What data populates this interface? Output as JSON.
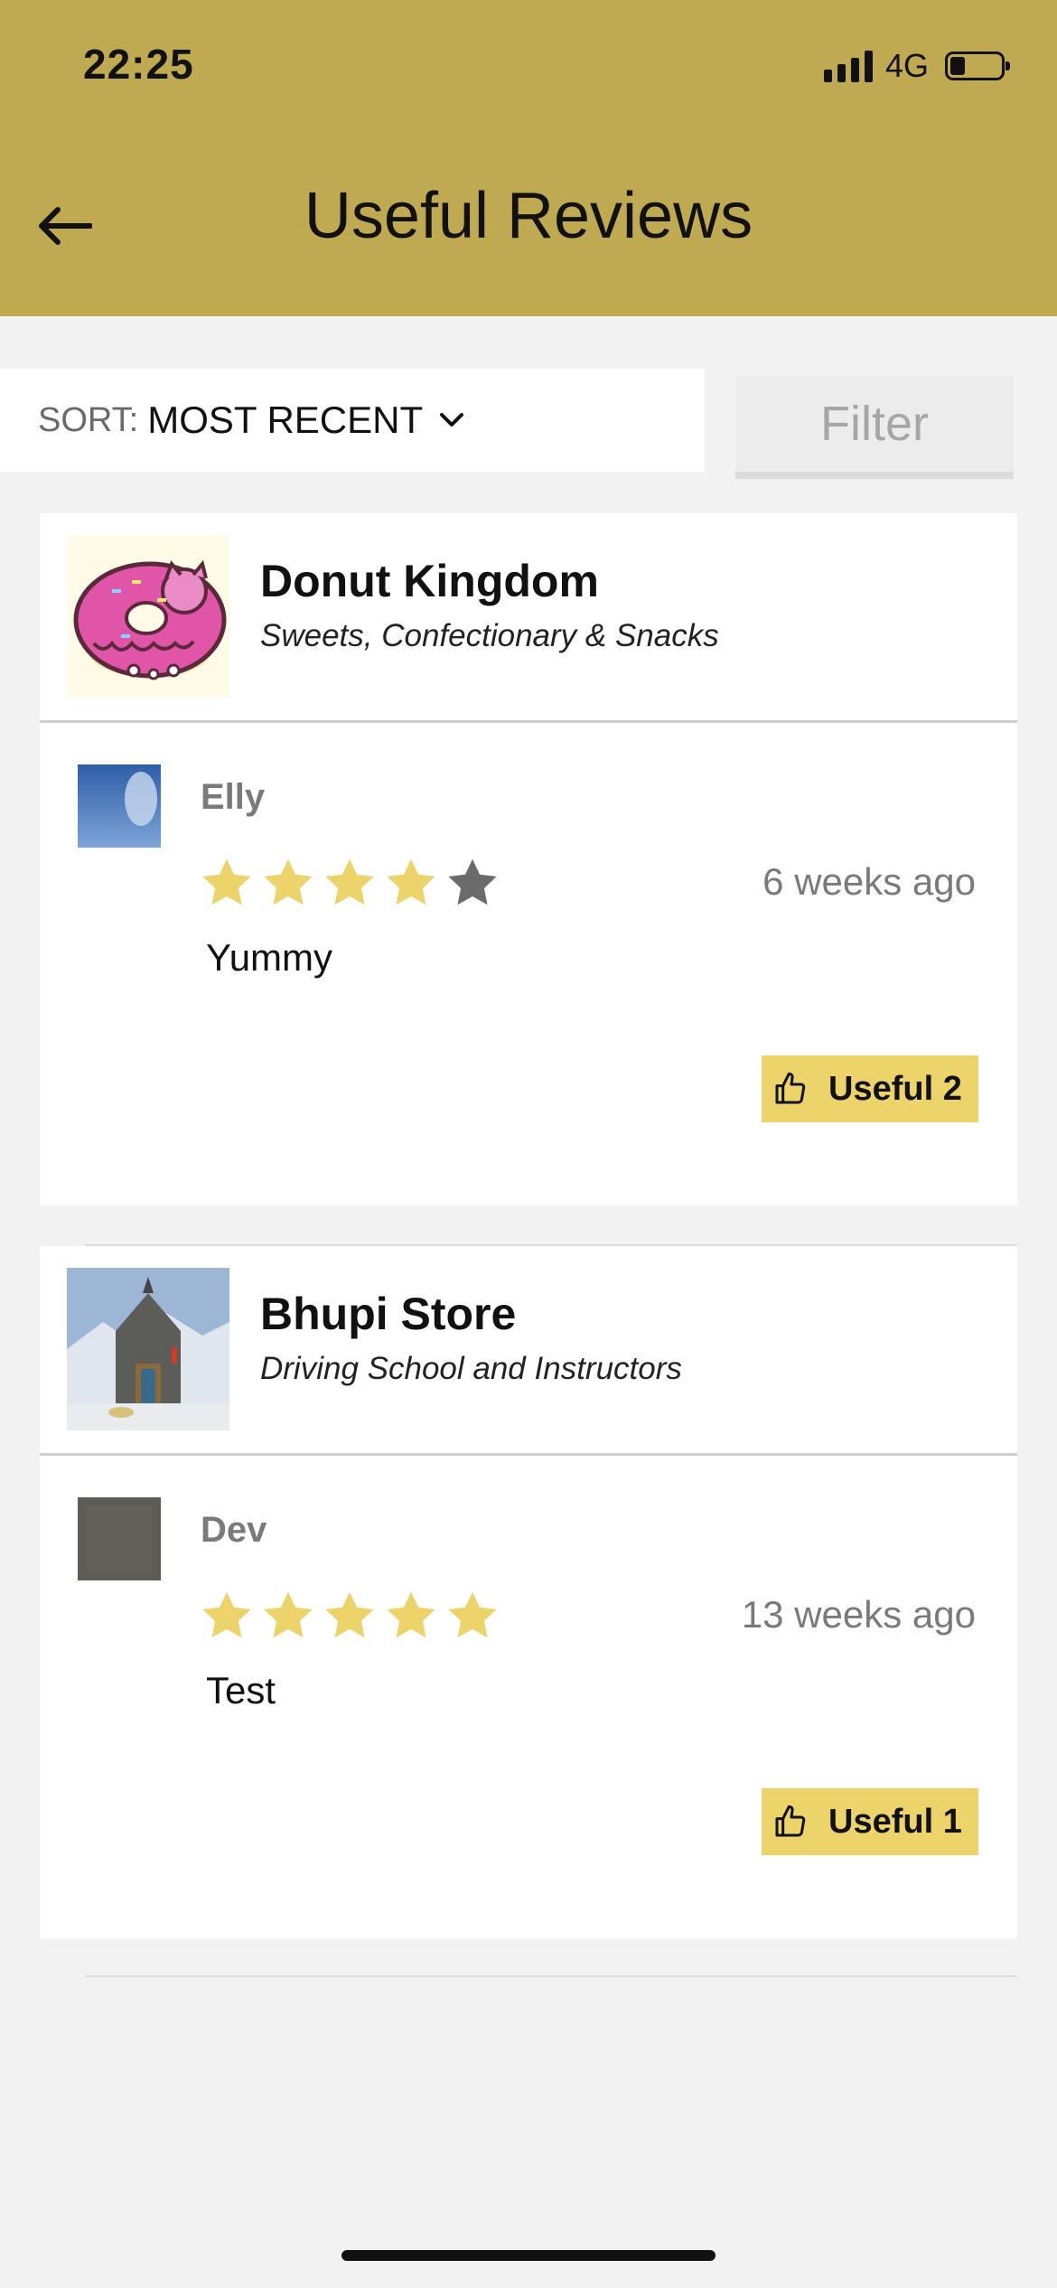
{
  "status_bar": {
    "time": "22:25",
    "network": "4G"
  },
  "header": {
    "title": "Useful Reviews",
    "back_icon": "arrow-left-icon"
  },
  "toolbar": {
    "sort_label": "SORT:",
    "sort_value": "MOST RECENT",
    "filter_label": "Filter"
  },
  "colors": {
    "header_bg": "#bfaa52",
    "star_filled": "#ecd46a",
    "star_empty": "#6b6b6b",
    "useful_bg": "#ecd46a"
  },
  "reviews": [
    {
      "business_name": "Donut Kingdom",
      "business_category": "Sweets, Confectionary & Snacks",
      "reviewer": "Elly",
      "rating": 4,
      "max_rating": 5,
      "time_ago": "6 weeks ago",
      "text": "Yummy",
      "useful_label": "Useful 2"
    },
    {
      "business_name": "Bhupi Store",
      "business_category": "Driving School and Instructors",
      "reviewer": "Dev",
      "rating": 5,
      "max_rating": 5,
      "time_ago": "13 weeks ago",
      "text": "Test",
      "useful_label": "Useful 1"
    }
  ]
}
